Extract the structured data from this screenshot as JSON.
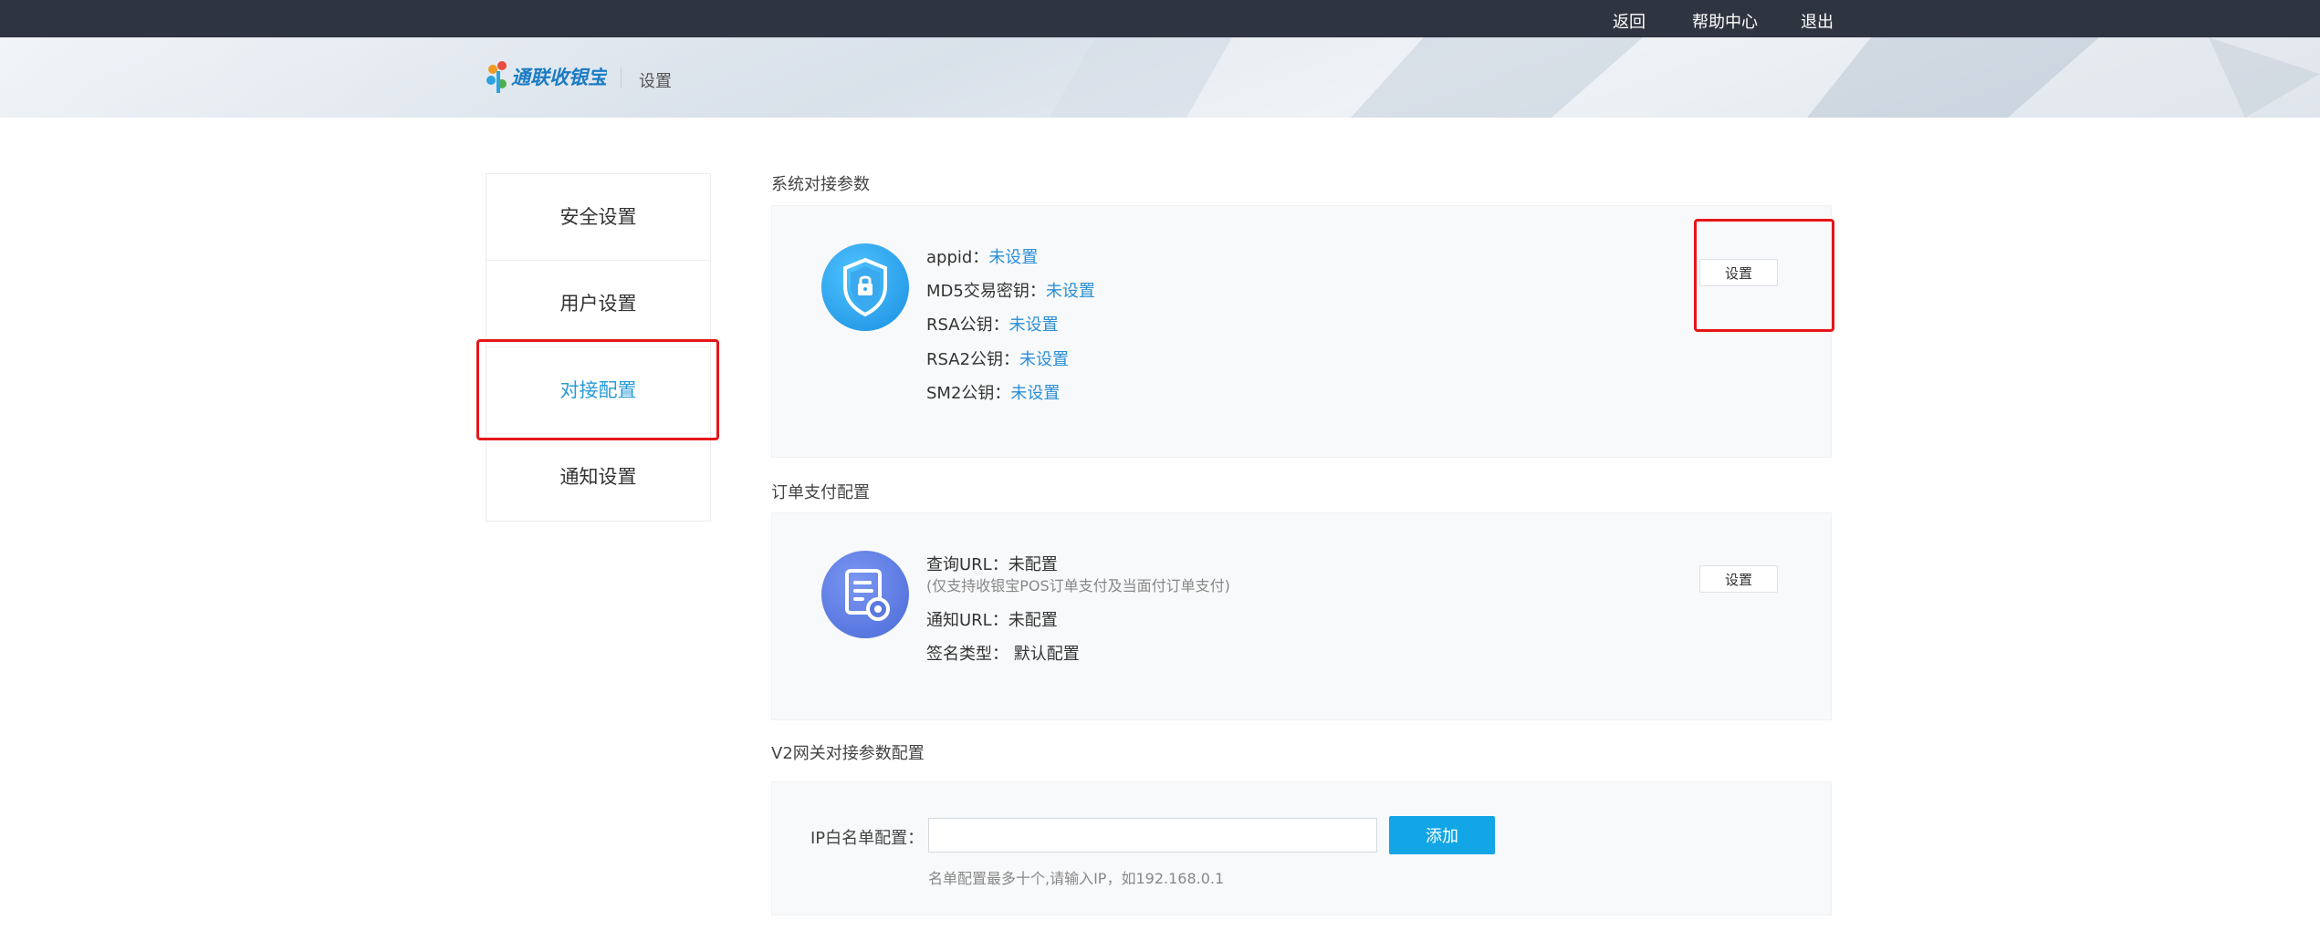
{
  "topbar": {
    "back": "返回",
    "help": "帮助中心",
    "logout": "退出"
  },
  "header": {
    "logo_text": "通联收银宝",
    "page_title": "设置"
  },
  "sidebar": {
    "items": [
      {
        "label": "安全设置"
      },
      {
        "label": "用户设置"
      },
      {
        "label": "对接配置"
      },
      {
        "label": "通知设置"
      }
    ]
  },
  "system_params": {
    "title": "系统对接参数",
    "rows": [
      {
        "label": "appid：",
        "value": "未设置"
      },
      {
        "label": "MD5交易密钥：",
        "value": "未设置"
      },
      {
        "label": "RSA公钥：",
        "value": "未设置"
      },
      {
        "label": "RSA2公钥：",
        "value": "未设置"
      },
      {
        "label": "SM2公钥：",
        "value": "未设置"
      }
    ],
    "button": "设置"
  },
  "order_pay": {
    "title": "订单支付配置",
    "query_url": "查询URL：未配置",
    "query_hint": "(仅支持收银宝POS订单支付及当面付订单支付)",
    "notify_url": "通知URL：未配置",
    "sign_type_label": "签名类型：",
    "sign_type_value": "默认配置",
    "button": "设置"
  },
  "v2_gateway": {
    "title": "V2网关对接参数配置",
    "ip_label": "IP白名单配置：",
    "ip_value": "",
    "add_button": "添加",
    "hint": "名单配置最多十个,请输入IP，如192.168.0.1"
  },
  "colors": {
    "accent": "#2a9bd6",
    "highlight": "#e5161a",
    "add_button": "#12a6e6",
    "topbar": "#2f3540"
  }
}
